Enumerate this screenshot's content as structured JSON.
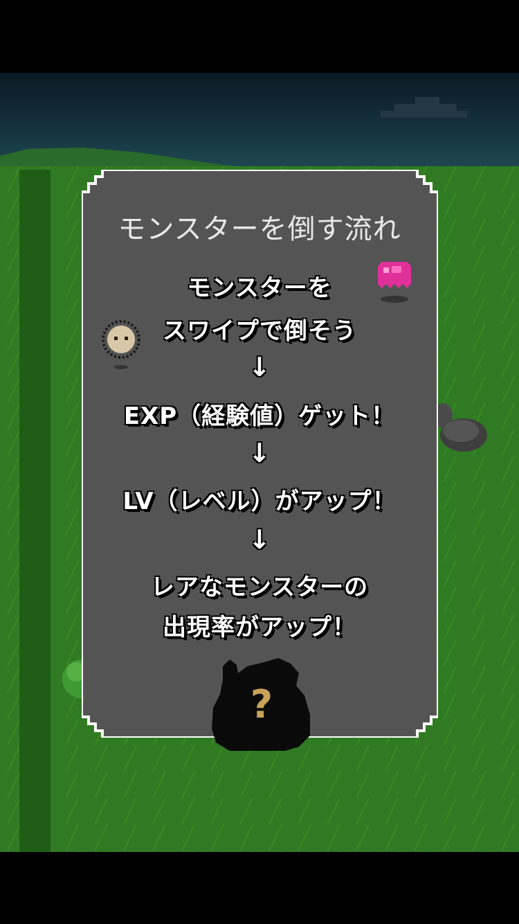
{
  "panel": {
    "title": "モンスターを倒す流れ",
    "steps": [
      "モンスターを",
      "スワイプで倒そう",
      "EXP（経験値）ゲット！",
      "LV（レベル）がアップ！",
      "レアなモンスターの",
      "出現率がアップ！"
    ],
    "arrow": "↓",
    "mystery_symbol": "?"
  },
  "colors": {
    "panel_bg": "#545454",
    "grass": "#2f7a22",
    "pink_monster": "#e0309a",
    "mystery_question": "#c9a25a"
  }
}
